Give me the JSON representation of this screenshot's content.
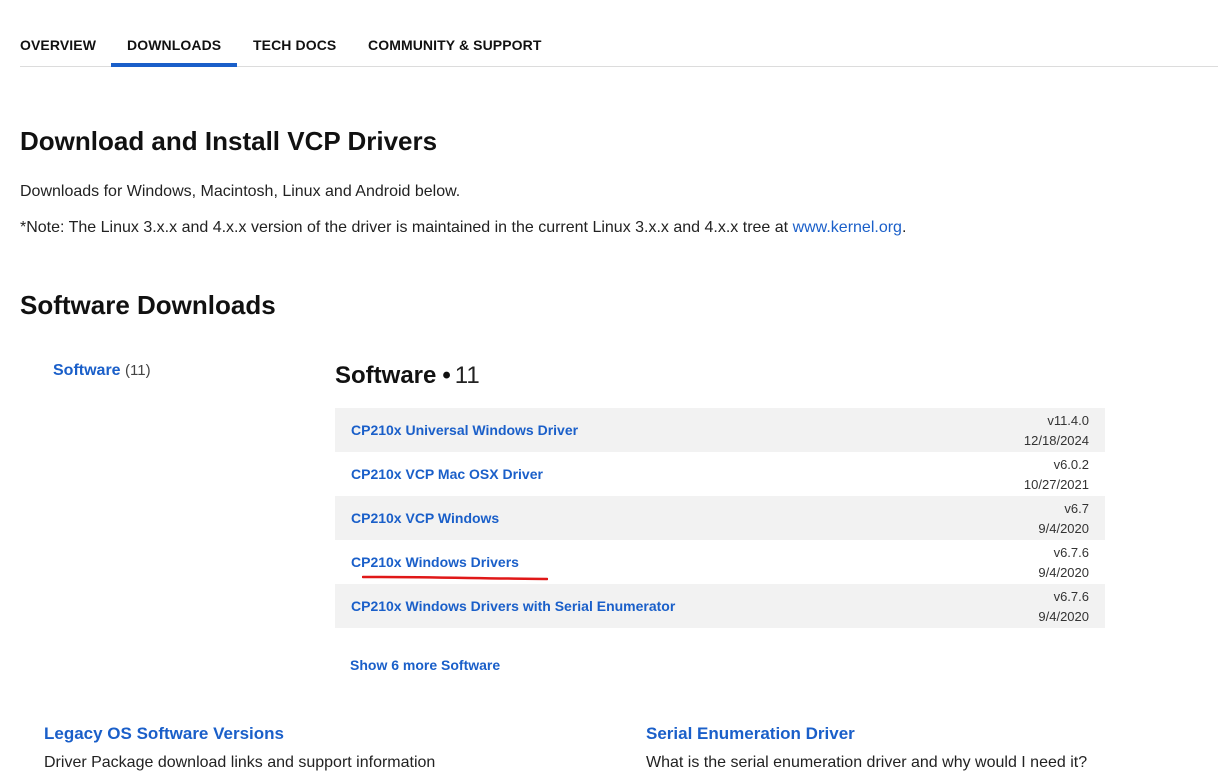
{
  "tabs": [
    {
      "label": "OVERVIEW"
    },
    {
      "label": "DOWNLOADS",
      "active": true
    },
    {
      "label": "TECH DOCS"
    },
    {
      "label": "COMMUNITY & SUPPORT"
    }
  ],
  "main": {
    "title": "Download and Install VCP Drivers",
    "intro": "Downloads for Windows, Macintosh, Linux and Android below.",
    "note_prefix": "*Note: The Linux 3.x.x and 4.x.x version of the driver is maintained in the current Linux 3.x.x and 4.x.x tree at ",
    "note_link": "www.kernel.org",
    "note_suffix": "."
  },
  "downloads": {
    "heading": "Software Downloads",
    "filter": {
      "label": "Software",
      "count": "(11)"
    },
    "list_title": "Software",
    "list_count": "11",
    "items": [
      {
        "name": "CP210x Universal Windows Driver",
        "version": "v11.4.0",
        "date": "12/18/2024"
      },
      {
        "name": "CP210x VCP Mac OSX Driver",
        "version": "v6.0.2",
        "date": "10/27/2021"
      },
      {
        "name": "CP210x VCP Windows",
        "version": "v6.7",
        "date": "9/4/2020"
      },
      {
        "name": "CP210x Windows Drivers",
        "version": "v6.7.6",
        "date": "9/4/2020"
      },
      {
        "name": "CP210x Windows Drivers with Serial Enumerator",
        "version": "v6.7.6",
        "date": "9/4/2020"
      }
    ],
    "show_more": "Show 6 more Software"
  },
  "sections": {
    "legacy": {
      "title": "Legacy OS Software Versions",
      "desc": "Driver Package download links and support information"
    },
    "serial": {
      "title": "Serial Enumeration Driver",
      "desc": "What is the serial enumeration driver and why would I need it?"
    }
  },
  "colors": {
    "link": "#1a5fc9",
    "annotation": "#e01818",
    "row_shade": "#f2f2f2"
  }
}
